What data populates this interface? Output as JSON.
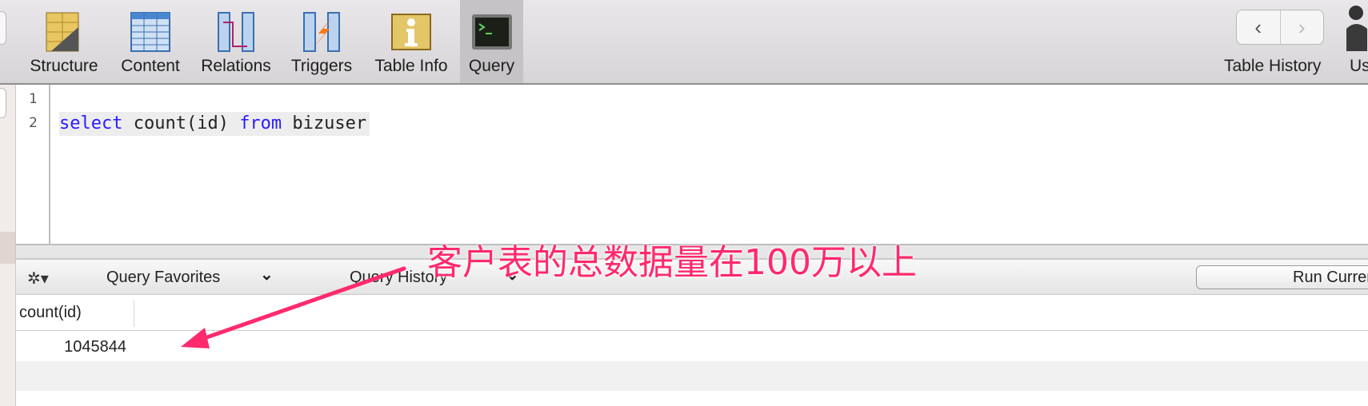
{
  "toolbar": {
    "items": [
      {
        "label": "Structure",
        "icon": "structure-icon"
      },
      {
        "label": "Content",
        "icon": "content-icon"
      },
      {
        "label": "Relations",
        "icon": "relations-icon"
      },
      {
        "label": "Triggers",
        "icon": "triggers-icon"
      },
      {
        "label": "Table Info",
        "icon": "table-info-icon"
      },
      {
        "label": "Query",
        "icon": "terminal-icon",
        "selected": true
      }
    ],
    "table_history_label": "Table History",
    "users_label": "Us",
    "back": "‹",
    "forward": "›"
  },
  "editor": {
    "line_numbers": [
      "1",
      "2"
    ],
    "code": {
      "kw1": "select",
      "t1": " count(id) ",
      "kw2": "from",
      "t2": " bizuser"
    }
  },
  "query_bar": {
    "gear": "✲▾",
    "favorites": "Query Favorites",
    "history": "Query History",
    "chevron": "⌄",
    "run": "Run Current"
  },
  "results": {
    "columns": [
      "count(id)"
    ],
    "rows": [
      [
        "1045844"
      ]
    ]
  },
  "annotation": {
    "text": "客户表的总数据量在100万以上",
    "color": "#ff2a6d"
  }
}
